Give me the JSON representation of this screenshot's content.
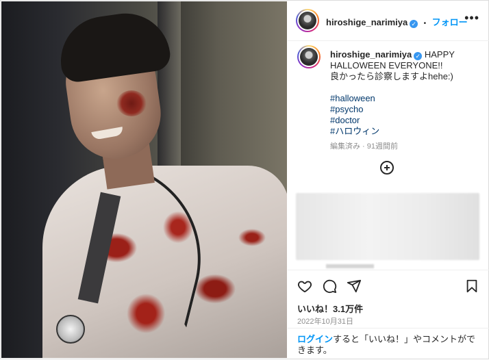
{
  "post": {
    "username": "hiroshige_narimiya",
    "follow_label": "フォロー",
    "separator": "•",
    "caption_lines": [
      "HAPPY HALLOWEEN EVERYONE!!",
      "良かったら診察しますよhehe:)"
    ],
    "hashtags": [
      "#halloween",
      "#psycho",
      "#doctor",
      "#ハロウィン"
    ],
    "meta": "編集済み · 91週間前",
    "likes": "いいね！3.1万件",
    "date": "2022年10月31日",
    "login_link": "ログイン",
    "login_rest": "すると「いいね！」やコメントができます。"
  },
  "icons": {
    "more": "more-dots-icon",
    "verified": "verified-badge-icon",
    "add": "plus-circle-icon",
    "like": "heart-icon",
    "comment": "comment-icon",
    "share": "share-icon",
    "save": "bookmark-icon"
  },
  "colors": {
    "accent": "#0095f6",
    "hashtag": "#00376b",
    "muted": "#8e8e8e",
    "verified": "#3897f0"
  }
}
